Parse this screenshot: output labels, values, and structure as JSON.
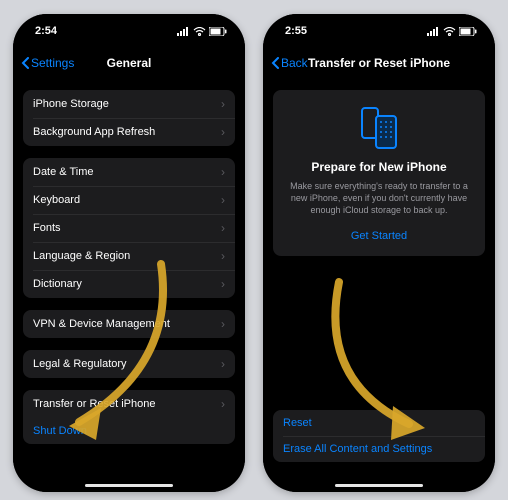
{
  "left": {
    "time": "2:54",
    "back_label": "Settings",
    "title": "General",
    "groups": [
      {
        "items": [
          "iPhone Storage",
          "Background App Refresh"
        ]
      },
      {
        "items": [
          "Date & Time",
          "Keyboard",
          "Fonts",
          "Language & Region",
          "Dictionary"
        ]
      },
      {
        "items": [
          "VPN & Device Management"
        ]
      },
      {
        "items": [
          "Legal & Regulatory"
        ]
      }
    ],
    "transfer_label": "Transfer or Reset iPhone",
    "shutdown_label": "Shut Down"
  },
  "right": {
    "time": "2:55",
    "back_label": "Back",
    "title": "Transfer or Reset iPhone",
    "card_title": "Prepare for New iPhone",
    "card_desc": "Make sure everything's ready to transfer to a new iPhone, even if you don't currently have enough iCloud storage to back up.",
    "card_link": "Get Started",
    "reset_label": "Reset",
    "erase_label": "Erase All Content and Settings"
  },
  "colors": {
    "accent": "#0a84ff",
    "arrow": "#d9a72a"
  }
}
